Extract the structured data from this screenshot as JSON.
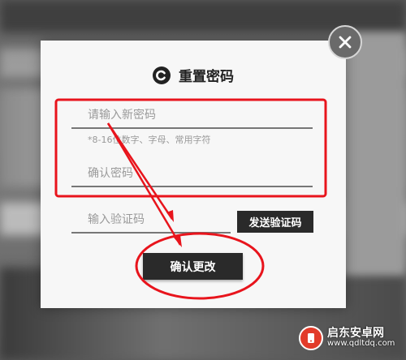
{
  "dialog": {
    "title": "重置密码",
    "new_password_placeholder": "请输入新密码",
    "password_hint": "*8-16位数字、字母、常用字符",
    "confirm_password_placeholder": "确认密码",
    "code_placeholder": "输入验证码",
    "send_code_label": "发送验证码",
    "confirm_change_label": "确认更改",
    "close_icon": "close-icon",
    "logo_icon": "app-logo-icon"
  },
  "annotations": {
    "highlight_color": "#e8141c"
  },
  "watermark": {
    "name": "启东安卓网",
    "url": "www.qdltdq.com",
    "brand_color": "#e23b2a"
  }
}
